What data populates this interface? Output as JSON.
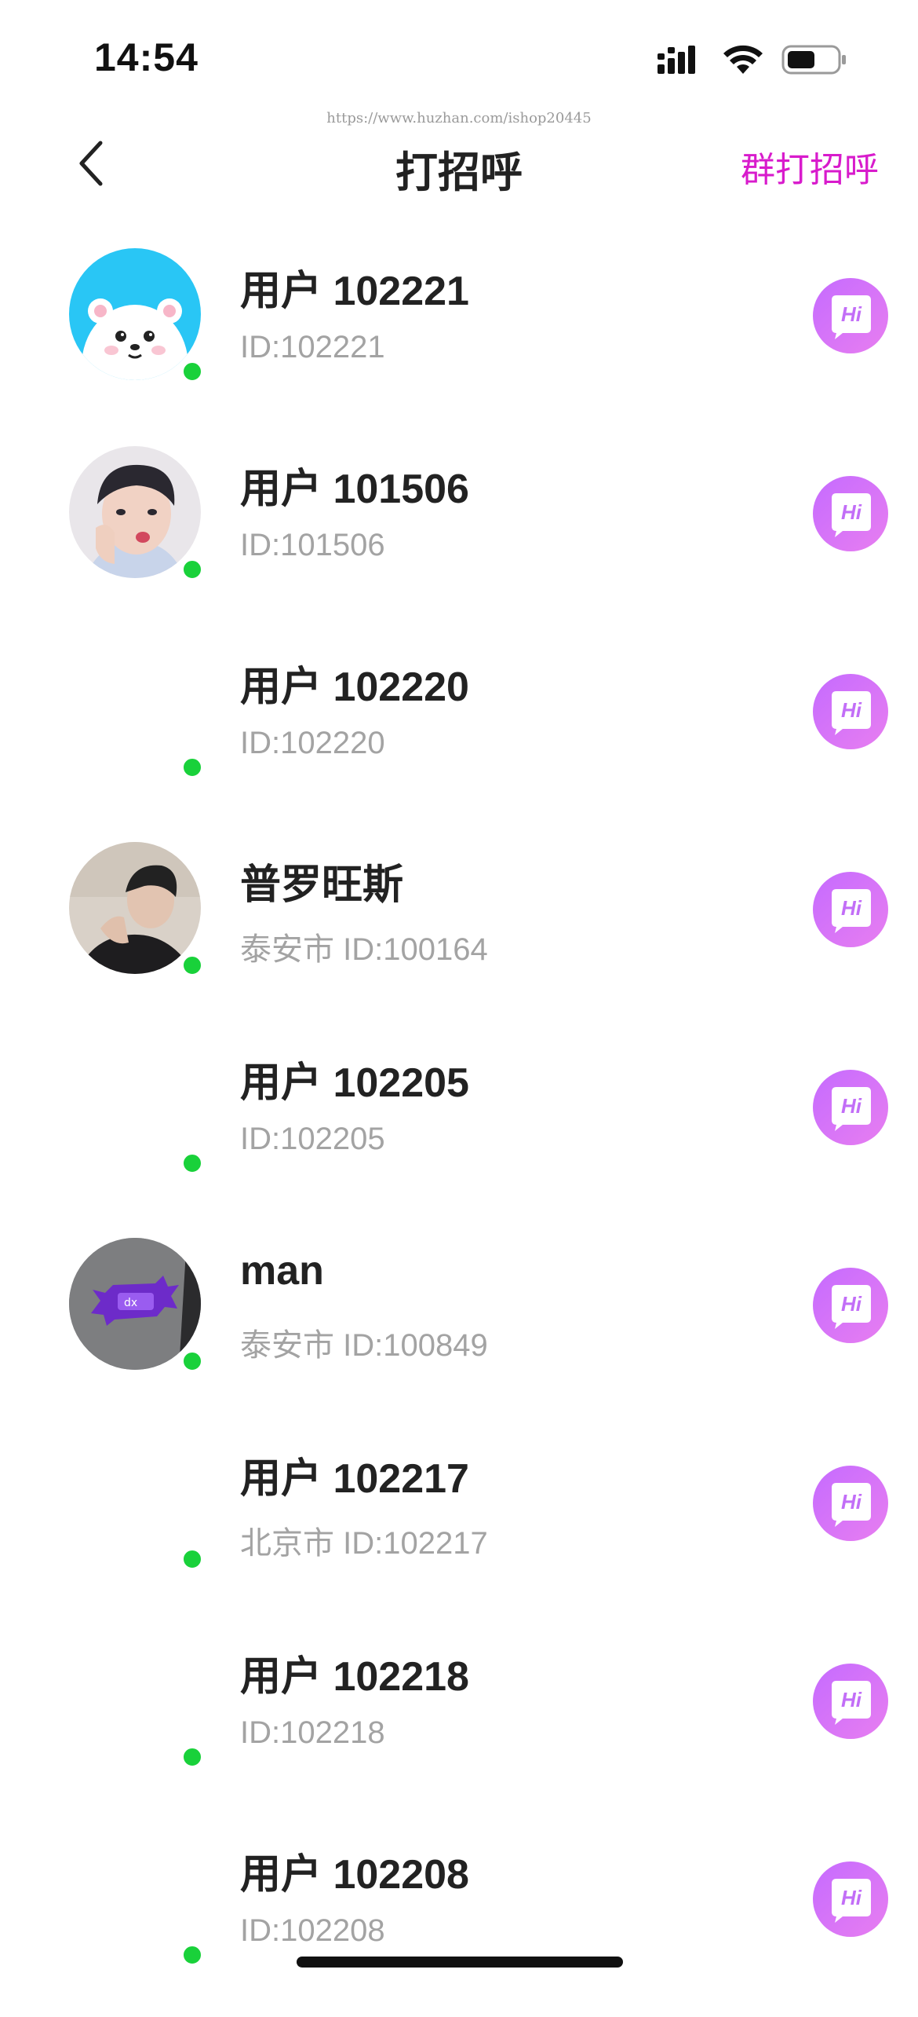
{
  "status_bar": {
    "time": "14:54"
  },
  "watermark": "https://www.huzhan.com/ishop20445",
  "nav": {
    "title": "打招呼",
    "group_button_label": "群打招呼"
  },
  "colors": {
    "accent": "#d81bcc",
    "online": "#19d13a",
    "hi_gradient": [
      "#c56bff",
      "#e87ef0"
    ]
  },
  "users": [
    {
      "name": "用户 102221",
      "subtitle": "ID:102221",
      "avatar": "bear",
      "online": true
    },
    {
      "name": "用户 101506",
      "subtitle": "ID:101506",
      "avatar": "photo-boy",
      "online": true
    },
    {
      "name": "用户 102220",
      "subtitle": "ID:102220",
      "avatar": "none",
      "online": true
    },
    {
      "name": "普罗旺斯",
      "subtitle": "泰安市 ID:100164",
      "avatar": "photo-man",
      "online": true
    },
    {
      "name": "用户 102205",
      "subtitle": "ID:102205",
      "avatar": "none",
      "online": true
    },
    {
      "name": "man",
      "subtitle": "泰安市 ID:100849",
      "avatar": "photo-candy",
      "online": true
    },
    {
      "name": "用户 102217",
      "subtitle": "北京市 ID:102217",
      "avatar": "none",
      "online": true
    },
    {
      "name": "用户 102218",
      "subtitle": "ID:102218",
      "avatar": "none",
      "online": true
    },
    {
      "name": "用户 102208",
      "subtitle": "ID:102208",
      "avatar": "none",
      "online": true
    }
  ],
  "hi_button_label": "Hi"
}
